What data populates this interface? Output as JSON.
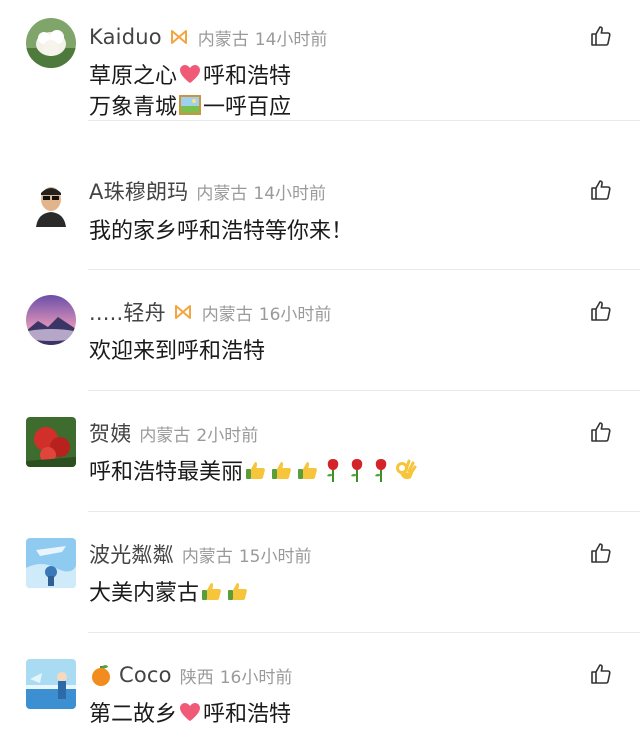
{
  "comments": [
    {
      "username": "Kaiduo",
      "has_badge": true,
      "location": "内蒙古",
      "time": "14小时前",
      "line1_a": "草原之心",
      "line1_emoji": "heart",
      "line1_b": "呼和浩特",
      "line2_a": "万象青城",
      "line2_emoji": "framed-picture",
      "line2_b": "一呼百应"
    },
    {
      "username": "A珠穆朗玛",
      "has_badge": false,
      "location": "内蒙古",
      "time": "14小时前",
      "line1": "我的家乡呼和浩特等你来！"
    },
    {
      "username": ".....轻舟",
      "has_badge": true,
      "location": "内蒙古",
      "time": "16小时前",
      "line1": "欢迎来到呼和浩特"
    },
    {
      "username": "贺姨",
      "has_badge": false,
      "location": "内蒙古",
      "time": "2小时前",
      "line1": "呼和浩特最美丽",
      "emojis": [
        "thumbs-up",
        "thumbs-up",
        "thumbs-up",
        "rose",
        "rose",
        "rose",
        "ok-hand"
      ]
    },
    {
      "username": "波光粼粼",
      "has_badge": false,
      "location": "内蒙古",
      "time": "15小时前",
      "line1": "大美内蒙古",
      "emojis": [
        "thumbs-up",
        "thumbs-up"
      ]
    },
    {
      "username": "Coco",
      "lead_emoji": "tangerine",
      "has_badge": false,
      "location": "陕西",
      "time": "16小时前",
      "line1_a": "第二故乡",
      "line1_emoji": "heart",
      "line1_b": "呼和浩特"
    }
  ],
  "icons": {
    "like": "thumbs-up-outline-icon",
    "badge": "infinity-badge-icon"
  },
  "colors": {
    "text": "#1a1a1a",
    "username": "#444444",
    "meta": "#9a9a9a",
    "badge": "#f2a640",
    "heart": "#f05a76",
    "divider": "#e9e9e9"
  }
}
